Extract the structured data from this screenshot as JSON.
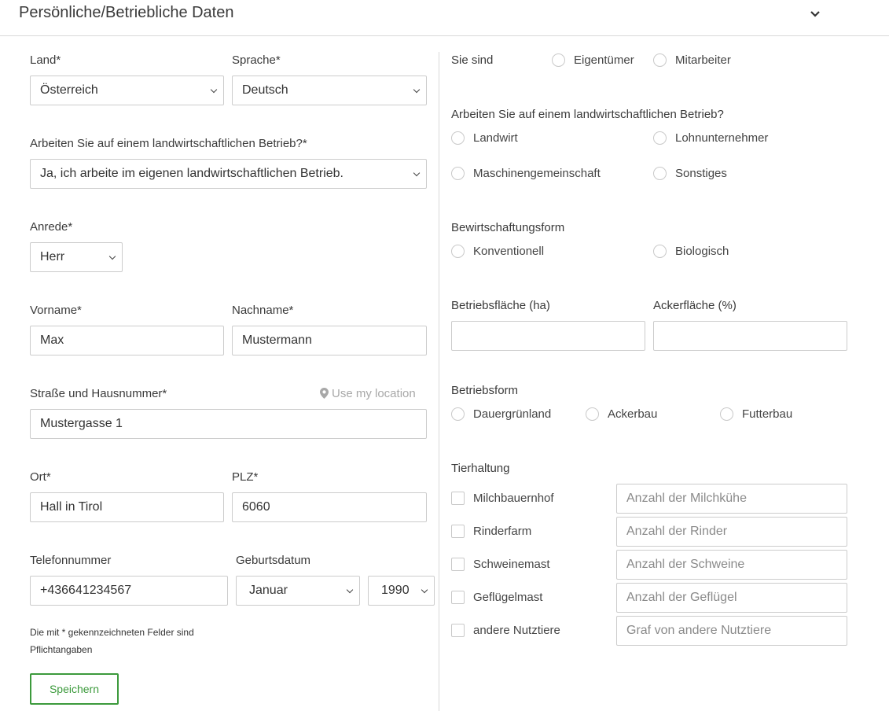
{
  "header": {
    "title": "Persönliche/Betriebliche Daten"
  },
  "left": {
    "land": {
      "label": "Land*",
      "value": "Österreich"
    },
    "sprache": {
      "label": "Sprache*",
      "value": "Deutsch"
    },
    "betrieb": {
      "label": "Arbeiten Sie auf einem landwirtschaftlichen Betrieb?*",
      "value": "Ja, ich arbeite im eigenen landwirtschaftlichen Betrieb."
    },
    "anrede": {
      "label": "Anrede*",
      "value": "Herr"
    },
    "vorname": {
      "label": "Vorname*",
      "value": "Max"
    },
    "nachname": {
      "label": "Nachname*",
      "value": "Mustermann"
    },
    "strasse": {
      "label": "Straße und Hausnummer*",
      "value": "Mustergasse 1",
      "location_link": "Use my location"
    },
    "ort": {
      "label": "Ort*",
      "value": "Hall in Tirol"
    },
    "plz": {
      "label": "PLZ*",
      "value": "6060"
    },
    "telefon": {
      "label": "Telefonnummer",
      "value": "+436641234567"
    },
    "geburtsdatum": {
      "label": "Geburtsdatum",
      "month": "Januar",
      "year": "1990"
    },
    "hint": "Die mit * gekennzeichneten Felder sind Pflichtangaben",
    "save_label": "Speichern"
  },
  "right": {
    "sie_sind": {
      "label": "Sie sind",
      "options": [
        "Eigentümer",
        "Mitarbeiter"
      ]
    },
    "betrieb": {
      "label": "Arbeiten Sie auf einem landwirtschaftlichen Betrieb?",
      "options": [
        "Landwirt",
        "Lohnunternehmer",
        "Maschinengemeinschaft",
        "Sonstiges"
      ]
    },
    "bewirtschaftung": {
      "label": "Bewirtschaftungsform",
      "options": [
        "Konventionell",
        "Biologisch"
      ]
    },
    "betriebsflaeche": {
      "label": "Betriebsfläche (ha)",
      "value": ""
    },
    "ackerflaeche": {
      "label": "Ackerfläche (%)",
      "value": ""
    },
    "betriebsform": {
      "label": "Betriebsform",
      "options": [
        "Dauergrünland",
        "Ackerbau",
        "Futterbau"
      ]
    },
    "tierhaltung": {
      "label": "Tierhaltung",
      "items": [
        {
          "label": "Milchbauernhof",
          "placeholder": "Anzahl der Milchkühe"
        },
        {
          "label": "Rinderfarm",
          "placeholder": "Anzahl der Rinder"
        },
        {
          "label": "Schweinemast",
          "placeholder": "Anzahl der Schweine"
        },
        {
          "label": "Geflügelmast",
          "placeholder": "Anzahl der Geflügel"
        },
        {
          "label": "andere Nutztiere",
          "placeholder": "Graf von andere Nutztiere"
        }
      ]
    }
  }
}
